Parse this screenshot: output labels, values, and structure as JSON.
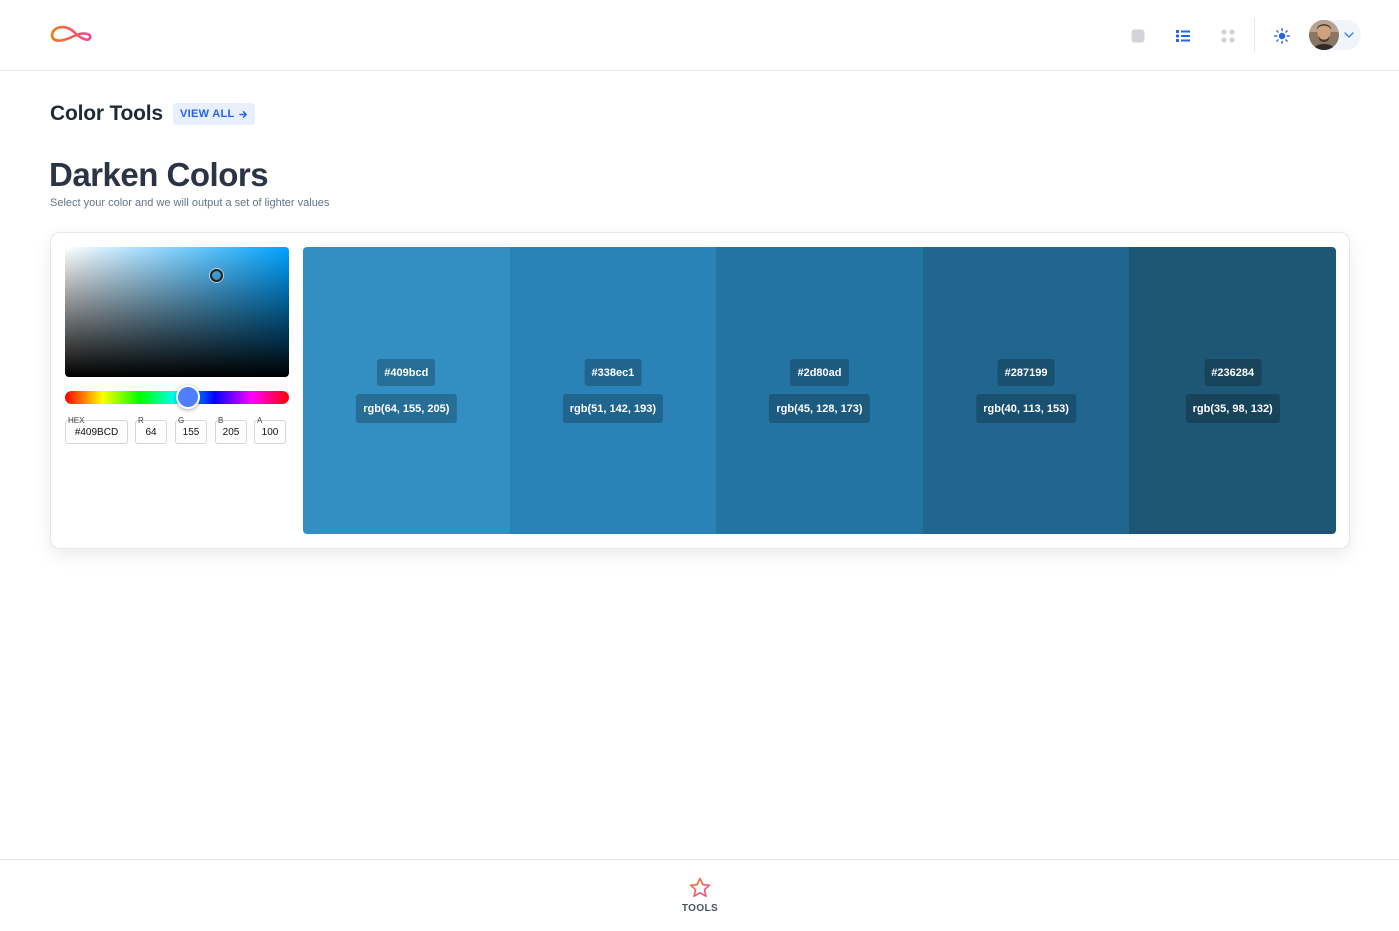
{
  "header": {
    "logo_icon": "loop-logo-icon",
    "view_buttons": [
      {
        "icon": "square-view-icon",
        "color": "#cbd5e1"
      },
      {
        "icon": "list-view-icon",
        "color": "#2563eb"
      },
      {
        "icon": "grid-view-icon",
        "color": "#cbd5e1"
      }
    ],
    "theme_icon": "sun-icon",
    "user_icon": "avatar",
    "menu_icon": "chevron-down-icon"
  },
  "section": {
    "title": "Color Tools",
    "view_all_label": "VIEW ALL",
    "view_all_icon": "arrow-right-icon"
  },
  "page": {
    "title": "Darken Colors",
    "subtitle": "Select your color and we will output a set of lighter values"
  },
  "picker": {
    "hue_fraction": 0.55,
    "fields": {
      "hex_label": "HEX",
      "hex_value": "#409BCD",
      "r_label": "R",
      "r_value": "64",
      "g_label": "G",
      "g_value": "155",
      "b_label": "B",
      "b_value": "205",
      "a_label": "A",
      "a_value": "100"
    }
  },
  "swatches": [
    {
      "hex": "#409bcd",
      "rgb": "rgb(64, 155, 205)",
      "fill": "#338ec1"
    },
    {
      "hex": "#338ec1",
      "rgb": "rgb(51, 142, 193)",
      "fill": "#2a82b7"
    },
    {
      "hex": "#2d80ad",
      "rgb": "rgb(45, 128, 173)",
      "fill": "#2474a3"
    },
    {
      "hex": "#287199",
      "rgb": "rgb(40, 113, 153)",
      "fill": "#20668f"
    },
    {
      "hex": "#236284",
      "rgb": "rgb(35, 98, 132)",
      "fill": "#1e5675"
    }
  ],
  "footer": {
    "tools_label": "TOOLS",
    "tools_icon": "star-icon"
  },
  "colors": {
    "accent": "#2563eb",
    "brand_gradient_start": "#f97316",
    "brand_gradient_end": "#ec4899"
  }
}
